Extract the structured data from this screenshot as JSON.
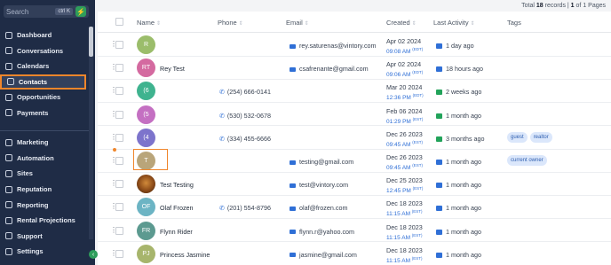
{
  "sidebar": {
    "search_placeholder": "Search",
    "search_shortcut": "ctrl K",
    "bolt_icon": "⚡",
    "collapse_icon": "‹",
    "items": [
      {
        "label": "Dashboard",
        "icon": "dashboard-icon"
      },
      {
        "label": "Conversations",
        "icon": "conversations-icon"
      },
      {
        "label": "Calendars",
        "icon": "calendar-icon"
      },
      {
        "label": "Contacts",
        "icon": "contacts-icon",
        "active": true
      },
      {
        "label": "Opportunities",
        "icon": "opportunities-icon"
      },
      {
        "label": "Payments",
        "icon": "payments-icon"
      }
    ],
    "items2": [
      {
        "label": "Marketing",
        "icon": "marketing-icon"
      },
      {
        "label": "Automation",
        "icon": "automation-icon"
      },
      {
        "label": "Sites",
        "icon": "sites-icon"
      },
      {
        "label": "Reputation",
        "icon": "star-icon"
      },
      {
        "label": "Reporting",
        "icon": "reporting-icon"
      },
      {
        "label": "Rental Projections",
        "icon": "rental-icon"
      },
      {
        "label": "Support",
        "icon": "support-icon"
      },
      {
        "label": "Settings",
        "icon": "settings-icon"
      }
    ]
  },
  "records": {
    "prefix": "Total",
    "count": "18",
    "suffix": "records |",
    "page": "1",
    "of": "of 1 Pages"
  },
  "table": {
    "headers": {
      "name": "Name",
      "phone": "Phone",
      "email": "Email",
      "created": "Created",
      "activity": "Last Activity",
      "tags": "Tags"
    },
    "sort_icon": "⇕",
    "rows": [
      {
        "initials": "R",
        "color": "#9bbd6b",
        "name": "",
        "phone": "",
        "email": "rey.saturenas@vintory.com",
        "date": "Apr 02 2024",
        "time": "09:08 AM",
        "tz": "(EDT)",
        "activity": "1 day ago",
        "activity_icon": "mail",
        "tags": []
      },
      {
        "initials": "RT",
        "color": "#d46aa0",
        "name": "Rey Test",
        "phone": "",
        "email": "csafrenante@gmail.com",
        "date": "Apr 02 2024",
        "time": "09:06 AM",
        "tz": "(EDT)",
        "activity": "18 hours ago",
        "activity_icon": "mail",
        "tags": []
      },
      {
        "initials": "(6",
        "color": "#3fb38f",
        "name": "",
        "phone": "(254) 666-0141",
        "email": "",
        "date": "Mar 20 2024",
        "time": "12:36 PM",
        "tz": "(EDT)",
        "activity": "2 weeks ago",
        "activity_icon": "sms",
        "tags": []
      },
      {
        "initials": "(5",
        "color": "#c470c2",
        "name": "",
        "phone": "(530) 532-0678",
        "email": "",
        "date": "Feb 06 2024",
        "time": "01:29 PM",
        "tz": "(EST)",
        "activity": "1 month ago",
        "activity_icon": "sms",
        "tags": []
      },
      {
        "initials": "(4",
        "color": "#7d74cc",
        "name": "",
        "phone": "(334) 455-6666",
        "email": "",
        "date": "Dec 26 2023",
        "time": "09:45 AM",
        "tz": "(EST)",
        "activity": "3 months ago",
        "activity_icon": "sms",
        "tags": [
          "guest",
          "realtor"
        ]
      },
      {
        "initials": "T",
        "color": "#b9a57a",
        "name": "",
        "phone": "",
        "email": "testing@gmail.com",
        "date": "Dec 26 2023",
        "time": "09:45 AM",
        "tz": "(EST)",
        "activity": "1 month ago",
        "activity_icon": "mail",
        "tags": [
          "current owner"
        ]
      },
      {
        "initials": "",
        "color": "lion",
        "name": "Test Testing",
        "phone": "",
        "email": "test@vintory.com",
        "date": "Dec 25 2023",
        "time": "12:45 PM",
        "tz": "(EST)",
        "activity": "1 month ago",
        "activity_icon": "mail",
        "tags": []
      },
      {
        "initials": "OF",
        "color": "#6cb4c4",
        "name": "Olaf Frozen",
        "phone": "(201) 554-8796",
        "email": "olaf@frozen.com",
        "date": "Dec 18 2023",
        "time": "11:15 AM",
        "tz": "(EST)",
        "activity": "1 month ago",
        "activity_icon": "mail",
        "tags": []
      },
      {
        "initials": "FR",
        "color": "#5c9a90",
        "name": "Flynn Rider",
        "phone": "",
        "email": "flynn.r@yahoo.com",
        "date": "Dec 18 2023",
        "time": "11:15 AM",
        "tz": "(EST)",
        "activity": "1 month ago",
        "activity_icon": "mail",
        "tags": []
      },
      {
        "initials": "PJ",
        "color": "#a7b56c",
        "name": "Princess Jasmine",
        "phone": "",
        "email": "jasmine@gmail.com",
        "date": "Dec 18 2023",
        "time": "11:15 AM",
        "tz": "(EST)",
        "activity": "1 month ago",
        "activity_icon": "mail",
        "tags": []
      }
    ]
  }
}
